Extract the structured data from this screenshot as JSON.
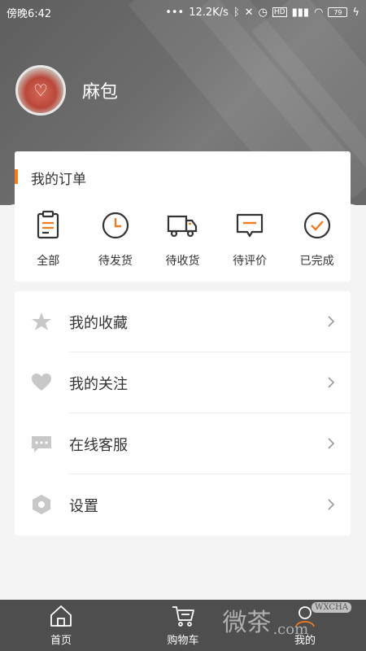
{
  "status_bar": {
    "time": "傍晚6:42",
    "network_speed": "12.2K/s",
    "battery": "79"
  },
  "profile": {
    "username": "麻包"
  },
  "orders": {
    "title": "我的订单",
    "accent_color": "#f07c1e",
    "items": [
      {
        "label": "全部",
        "icon": "clipboard-icon"
      },
      {
        "label": "待发货",
        "icon": "clock-icon"
      },
      {
        "label": "待收货",
        "icon": "truck-icon"
      },
      {
        "label": "待评价",
        "icon": "comment-icon"
      },
      {
        "label": "已完成",
        "icon": "check-circle-icon"
      }
    ]
  },
  "menu": {
    "items": [
      {
        "label": "我的收藏",
        "icon": "star-icon"
      },
      {
        "label": "我的关注",
        "icon": "heart-icon"
      },
      {
        "label": "在线客服",
        "icon": "chat-icon"
      },
      {
        "label": "设置",
        "icon": "hexagon-settings-icon"
      }
    ]
  },
  "tabbar": {
    "items": [
      {
        "label": "首页",
        "icon": "home-icon"
      },
      {
        "label": "购物车",
        "icon": "cart-icon"
      },
      {
        "label": "我的",
        "icon": "profile-icon"
      }
    ]
  },
  "watermark": {
    "text": "微茶",
    "badge": "WXCHA",
    "domain": ".com"
  }
}
